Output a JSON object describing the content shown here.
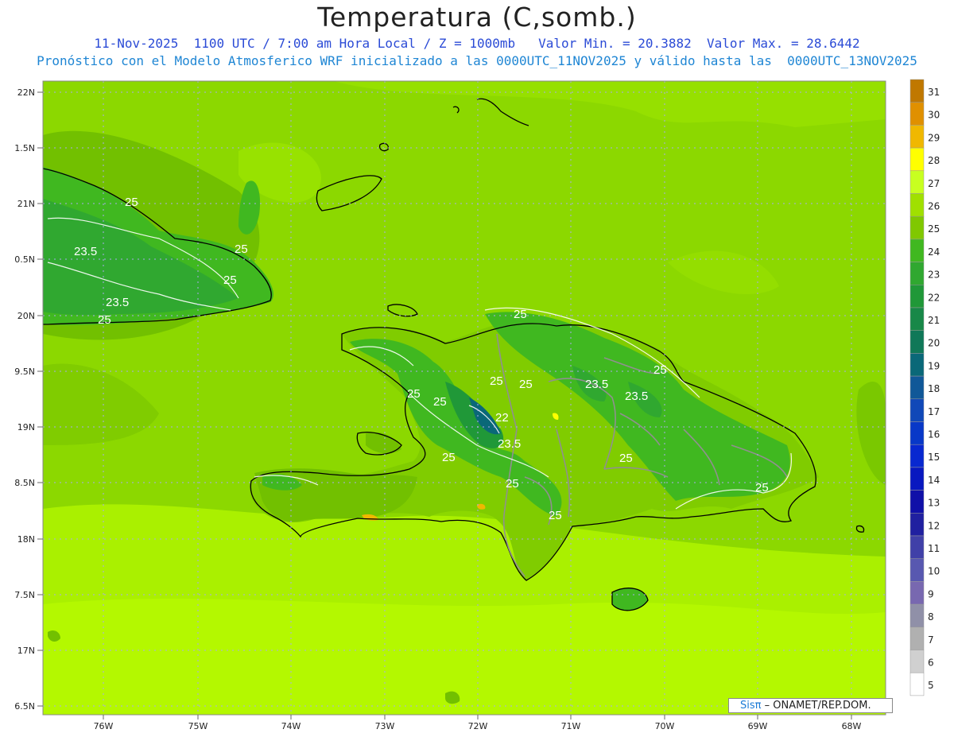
{
  "header": {
    "title": "Temperatura (C,somb.)",
    "subtitle_1": "11-Nov-2025  1100 UTC / 7:00 am Hora Local / Z = 1000mb   Valor Min. = 20.3882  Valor Max. = 28.6442",
    "subtitle_2": "Pronóstico con el Modelo Atmosferico WRF inicializado a las 0000UTC_11NOV2025 y válido hasta las  0000UTC_13NOV2025"
  },
  "axes": {
    "lat_labels": [
      "22N",
      "1.5N",
      "21N",
      "0.5N",
      "20N",
      "9.5N",
      "19N",
      "8.5N",
      "18N",
      "7.5N",
      "17N",
      "6.5N"
    ],
    "lon_labels": [
      "76W",
      "75W",
      "74W",
      "73W",
      "72W",
      "71W",
      "70W",
      "69W",
      "68W"
    ]
  },
  "colorbar": {
    "labels": [
      "31",
      "30",
      "29",
      "28",
      "27",
      "26",
      "25",
      "24",
      "23",
      "22",
      "21",
      "20",
      "19",
      "18",
      "17",
      "16",
      "15",
      "14",
      "13",
      "12",
      "11",
      "10",
      "9",
      "8",
      "7",
      "6",
      "5"
    ],
    "colors": [
      "#c07800",
      "#e09000",
      "#f0b800",
      "#ffff00",
      "#c8ff20",
      "#a0e000",
      "#80c800",
      "#40b820",
      "#30a830",
      "#209838",
      "#188848",
      "#107858",
      "#0a6878",
      "#105898",
      "#1048b8",
      "#0838c8",
      "#0828d0",
      "#0818c0",
      "#1010a8",
      "#2020a0",
      "#4040a8",
      "#5858b0",
      "#7868b0",
      "#9090a8",
      "#b0b0b0",
      "#d0d0d0",
      "#ffffff"
    ]
  },
  "contour_labels": [
    "25",
    "23.5",
    "23.5",
    "25",
    "25",
    "25",
    "25",
    "25",
    "25",
    "25",
    "23.5",
    "23.5",
    "25",
    "25",
    "22",
    "25",
    "23.5",
    "25",
    "25",
    "25",
    "25",
    "25"
  ],
  "credit": {
    "brand": "Sisπ",
    "org": " – ONAMET/REP.DOM."
  }
}
